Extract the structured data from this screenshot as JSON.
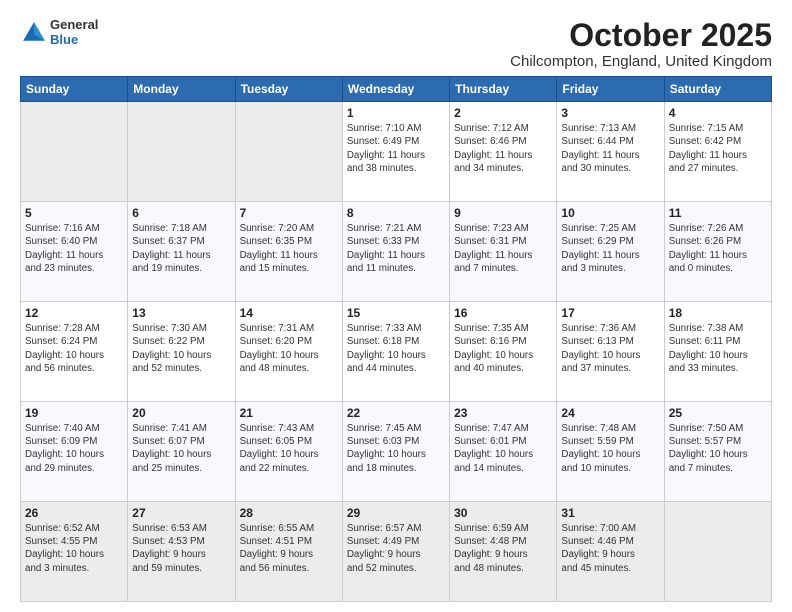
{
  "header": {
    "logo_general": "General",
    "logo_blue": "Blue",
    "month_title": "October 2025",
    "location": "Chilcompton, England, United Kingdom"
  },
  "weekdays": [
    "Sunday",
    "Monday",
    "Tuesday",
    "Wednesday",
    "Thursday",
    "Friday",
    "Saturday"
  ],
  "weeks": [
    [
      {
        "day": "",
        "info": ""
      },
      {
        "day": "",
        "info": ""
      },
      {
        "day": "",
        "info": ""
      },
      {
        "day": "1",
        "info": "Sunrise: 7:10 AM\nSunset: 6:49 PM\nDaylight: 11 hours\nand 38 minutes."
      },
      {
        "day": "2",
        "info": "Sunrise: 7:12 AM\nSunset: 6:46 PM\nDaylight: 11 hours\nand 34 minutes."
      },
      {
        "day": "3",
        "info": "Sunrise: 7:13 AM\nSunset: 6:44 PM\nDaylight: 11 hours\nand 30 minutes."
      },
      {
        "day": "4",
        "info": "Sunrise: 7:15 AM\nSunset: 6:42 PM\nDaylight: 11 hours\nand 27 minutes."
      }
    ],
    [
      {
        "day": "5",
        "info": "Sunrise: 7:16 AM\nSunset: 6:40 PM\nDaylight: 11 hours\nand 23 minutes."
      },
      {
        "day": "6",
        "info": "Sunrise: 7:18 AM\nSunset: 6:37 PM\nDaylight: 11 hours\nand 19 minutes."
      },
      {
        "day": "7",
        "info": "Sunrise: 7:20 AM\nSunset: 6:35 PM\nDaylight: 11 hours\nand 15 minutes."
      },
      {
        "day": "8",
        "info": "Sunrise: 7:21 AM\nSunset: 6:33 PM\nDaylight: 11 hours\nand 11 minutes."
      },
      {
        "day": "9",
        "info": "Sunrise: 7:23 AM\nSunset: 6:31 PM\nDaylight: 11 hours\nand 7 minutes."
      },
      {
        "day": "10",
        "info": "Sunrise: 7:25 AM\nSunset: 6:29 PM\nDaylight: 11 hours\nand 3 minutes."
      },
      {
        "day": "11",
        "info": "Sunrise: 7:26 AM\nSunset: 6:26 PM\nDaylight: 11 hours\nand 0 minutes."
      }
    ],
    [
      {
        "day": "12",
        "info": "Sunrise: 7:28 AM\nSunset: 6:24 PM\nDaylight: 10 hours\nand 56 minutes."
      },
      {
        "day": "13",
        "info": "Sunrise: 7:30 AM\nSunset: 6:22 PM\nDaylight: 10 hours\nand 52 minutes."
      },
      {
        "day": "14",
        "info": "Sunrise: 7:31 AM\nSunset: 6:20 PM\nDaylight: 10 hours\nand 48 minutes."
      },
      {
        "day": "15",
        "info": "Sunrise: 7:33 AM\nSunset: 6:18 PM\nDaylight: 10 hours\nand 44 minutes."
      },
      {
        "day": "16",
        "info": "Sunrise: 7:35 AM\nSunset: 6:16 PM\nDaylight: 10 hours\nand 40 minutes."
      },
      {
        "day": "17",
        "info": "Sunrise: 7:36 AM\nSunset: 6:13 PM\nDaylight: 10 hours\nand 37 minutes."
      },
      {
        "day": "18",
        "info": "Sunrise: 7:38 AM\nSunset: 6:11 PM\nDaylight: 10 hours\nand 33 minutes."
      }
    ],
    [
      {
        "day": "19",
        "info": "Sunrise: 7:40 AM\nSunset: 6:09 PM\nDaylight: 10 hours\nand 29 minutes."
      },
      {
        "day": "20",
        "info": "Sunrise: 7:41 AM\nSunset: 6:07 PM\nDaylight: 10 hours\nand 25 minutes."
      },
      {
        "day": "21",
        "info": "Sunrise: 7:43 AM\nSunset: 6:05 PM\nDaylight: 10 hours\nand 22 minutes."
      },
      {
        "day": "22",
        "info": "Sunrise: 7:45 AM\nSunset: 6:03 PM\nDaylight: 10 hours\nand 18 minutes."
      },
      {
        "day": "23",
        "info": "Sunrise: 7:47 AM\nSunset: 6:01 PM\nDaylight: 10 hours\nand 14 minutes."
      },
      {
        "day": "24",
        "info": "Sunrise: 7:48 AM\nSunset: 5:59 PM\nDaylight: 10 hours\nand 10 minutes."
      },
      {
        "day": "25",
        "info": "Sunrise: 7:50 AM\nSunset: 5:57 PM\nDaylight: 10 hours\nand 7 minutes."
      }
    ],
    [
      {
        "day": "26",
        "info": "Sunrise: 6:52 AM\nSunset: 4:55 PM\nDaylight: 10 hours\nand 3 minutes."
      },
      {
        "day": "27",
        "info": "Sunrise: 6:53 AM\nSunset: 4:53 PM\nDaylight: 9 hours\nand 59 minutes."
      },
      {
        "day": "28",
        "info": "Sunrise: 6:55 AM\nSunset: 4:51 PM\nDaylight: 9 hours\nand 56 minutes."
      },
      {
        "day": "29",
        "info": "Sunrise: 6:57 AM\nSunset: 4:49 PM\nDaylight: 9 hours\nand 52 minutes."
      },
      {
        "day": "30",
        "info": "Sunrise: 6:59 AM\nSunset: 4:48 PM\nDaylight: 9 hours\nand 48 minutes."
      },
      {
        "day": "31",
        "info": "Sunrise: 7:00 AM\nSunset: 4:46 PM\nDaylight: 9 hours\nand 45 minutes."
      },
      {
        "day": "",
        "info": ""
      }
    ]
  ]
}
